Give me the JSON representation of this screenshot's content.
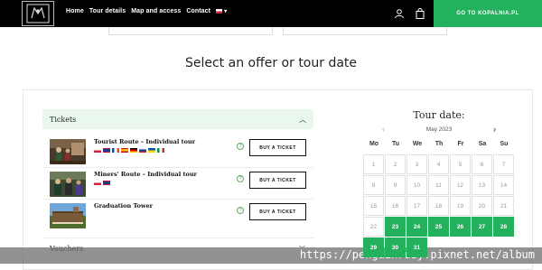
{
  "header": {
    "nav": [
      "Home",
      "Tour details",
      "Map and access",
      "Contact"
    ],
    "cta_label": "GO TO KOPALNIA.PL",
    "colors": {
      "bar": "#000000",
      "accent": "#24b15e"
    }
  },
  "main": {
    "heading": "Select an offer or tour date",
    "tickets": {
      "header_label": "Tickets",
      "tours": [
        {
          "title": "Tourist Route – Individual tour",
          "buy_label": "BUY A TICKET",
          "flags": [
            "pl",
            "gb",
            "fr",
            "es",
            "de",
            "ru",
            "ua",
            "it"
          ]
        },
        {
          "title": "Miners' Route – Individual tour",
          "buy_label": "BUY A TICKET",
          "flags": [
            "pl",
            "gb"
          ]
        },
        {
          "title": "Graduation Tower",
          "buy_label": "BUY A TICKET",
          "flags": []
        }
      ]
    },
    "vouchers_label": "Vouchers"
  },
  "calendar": {
    "title": "Tour date:",
    "month": "May 2023",
    "weekdays": [
      "Mo",
      "Tu",
      "We",
      "Th",
      "Fr",
      "Sa",
      "Su"
    ],
    "days": [
      "1",
      "2",
      "3",
      "4",
      "5",
      "6",
      "7",
      "8",
      "9",
      "10",
      "11",
      "12",
      "13",
      "14",
      "15",
      "16",
      "17",
      "18",
      "19",
      "20",
      "21",
      "22",
      "23",
      "24",
      "25",
      "26",
      "27",
      "28",
      "29",
      "30",
      "31"
    ],
    "available": [
      "23",
      "24",
      "25",
      "26",
      "27",
      "28",
      "29",
      "30",
      "31"
    ]
  },
  "watermark": "https://penguinruby.pixnet.net/album"
}
